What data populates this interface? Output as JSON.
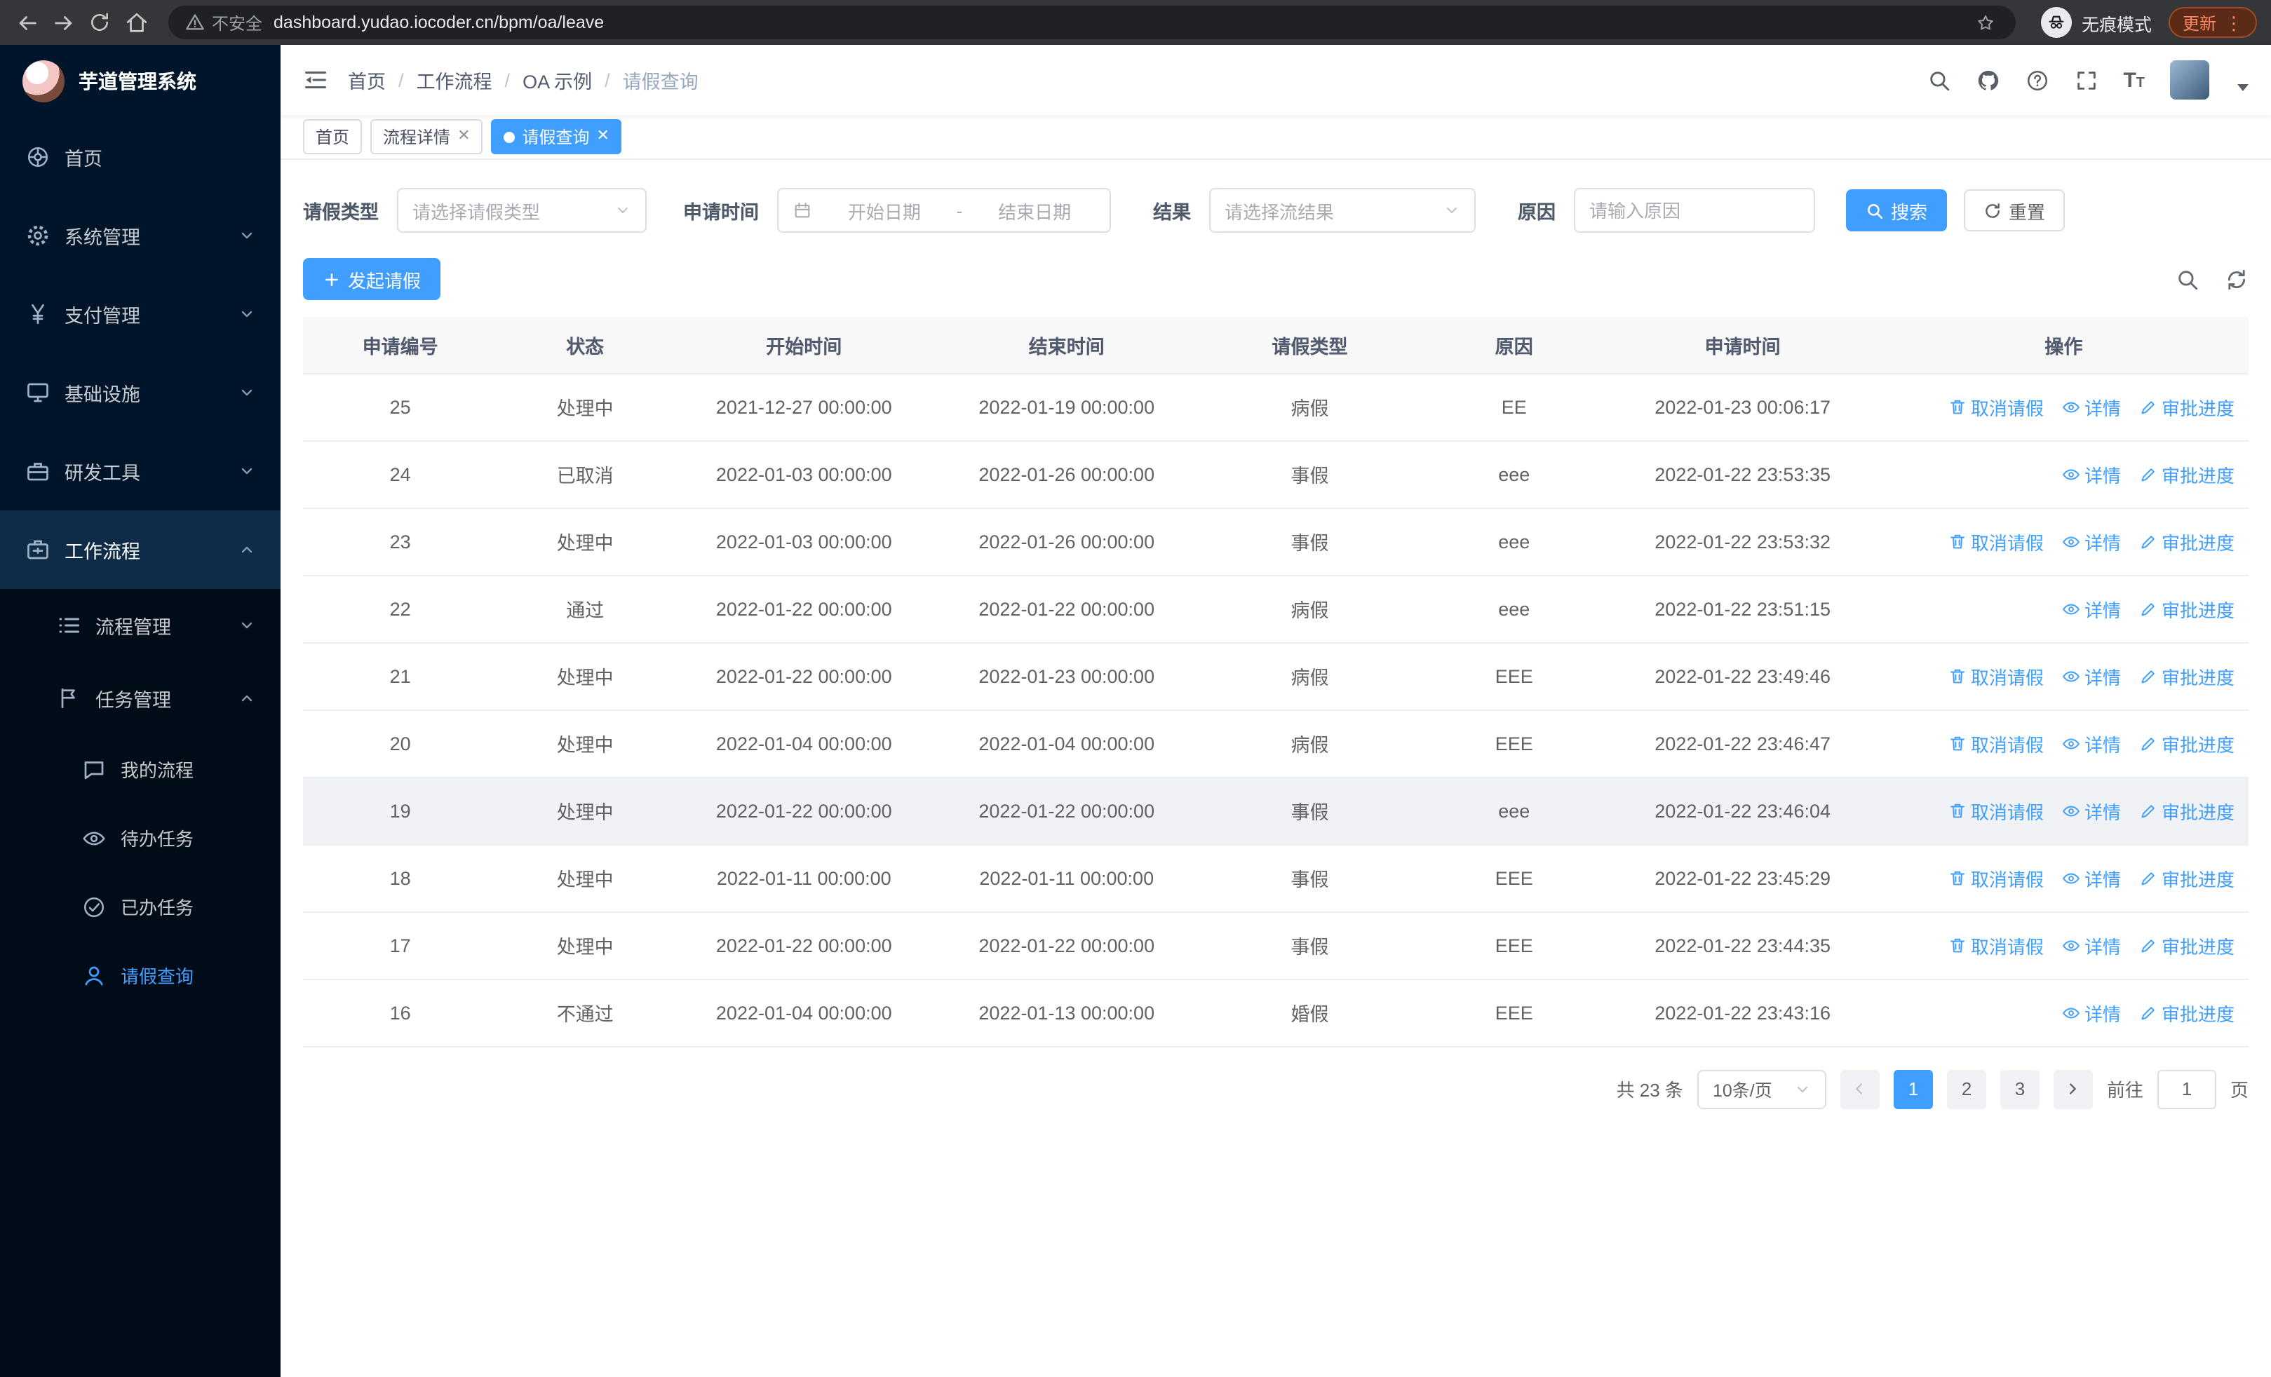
{
  "colors": {
    "primary": "#409eff",
    "sidebar_bg": "#001529",
    "submenu_bg": "#000c17",
    "chrome_bg": "#35363a",
    "header_text": "#515a6e"
  },
  "browser": {
    "security_label": "不安全",
    "url": "dashboard.yudao.iocoder.cn/bpm/oa/leave",
    "incognito_label": "无痕模式",
    "update_label": "更新"
  },
  "sidebar": {
    "logo_title": "芋道管理系统",
    "items": [
      {
        "label": "首页",
        "icon": "home-wheel-icon"
      },
      {
        "label": "系统管理",
        "icon": "gear-icon"
      },
      {
        "label": "支付管理",
        "icon": "yen-icon"
      },
      {
        "label": "基础设施",
        "icon": "monitor-icon"
      },
      {
        "label": "研发工具",
        "icon": "toolbox-icon"
      },
      {
        "label": "工作流程",
        "icon": "briefcase-icon"
      }
    ],
    "workflow_children": [
      {
        "label": "流程管理",
        "icon": "list-icon"
      },
      {
        "label": "任务管理",
        "icon": "flag-icon"
      }
    ],
    "task_children": [
      {
        "label": "我的流程",
        "icon": "chat-icon"
      },
      {
        "label": "待办任务",
        "icon": "eye-icon"
      },
      {
        "label": "已办任务",
        "icon": "check-circle-icon"
      },
      {
        "label": "请假查询",
        "icon": "user-icon"
      }
    ]
  },
  "header": {
    "breadcrumb": [
      "首页",
      "工作流程",
      "OA 示例",
      "请假查询"
    ]
  },
  "tabs": [
    {
      "label": "首页"
    },
    {
      "label": "流程详情"
    },
    {
      "label": "请假查询"
    }
  ],
  "filters": {
    "leave_type": {
      "label": "请假类型",
      "placeholder": "请选择请假类型"
    },
    "apply_time": {
      "label": "申请时间",
      "start_placeholder": "开始日期",
      "separator": "-",
      "end_placeholder": "结束日期"
    },
    "result": {
      "label": "结果",
      "placeholder": "请选择流结果"
    },
    "reason": {
      "label": "原因",
      "placeholder": "请输入原因"
    },
    "search_label": "搜索",
    "reset_label": "重置"
  },
  "toolbar": {
    "create_label": "发起请假"
  },
  "table": {
    "headers": [
      "申请编号",
      "状态",
      "开始时间",
      "结束时间",
      "请假类型",
      "原因",
      "申请时间",
      "操作"
    ],
    "action_labels": {
      "cancel": "取消请假",
      "detail": "详情",
      "progress": "审批进度"
    },
    "rows": [
      {
        "id": "25",
        "status": "处理中",
        "start": "2021-12-27 00:00:00",
        "end": "2022-01-19 00:00:00",
        "type": "病假",
        "reason": "EE",
        "applied": "2022-01-23 00:06:17",
        "actions": [
          "cancel",
          "detail",
          "progress"
        ]
      },
      {
        "id": "24",
        "status": "已取消",
        "start": "2022-01-03 00:00:00",
        "end": "2022-01-26 00:00:00",
        "type": "事假",
        "reason": "eee",
        "applied": "2022-01-22 23:53:35",
        "actions": [
          "detail",
          "progress"
        ]
      },
      {
        "id": "23",
        "status": "处理中",
        "start": "2022-01-03 00:00:00",
        "end": "2022-01-26 00:00:00",
        "type": "事假",
        "reason": "eee",
        "applied": "2022-01-22 23:53:32",
        "actions": [
          "cancel",
          "detail",
          "progress"
        ]
      },
      {
        "id": "22",
        "status": "通过",
        "start": "2022-01-22 00:00:00",
        "end": "2022-01-22 00:00:00",
        "type": "病假",
        "reason": "eee",
        "applied": "2022-01-22 23:51:15",
        "actions": [
          "detail",
          "progress"
        ]
      },
      {
        "id": "21",
        "status": "处理中",
        "start": "2022-01-22 00:00:00",
        "end": "2022-01-23 00:00:00",
        "type": "病假",
        "reason": "EEE",
        "applied": "2022-01-22 23:49:46",
        "actions": [
          "cancel",
          "detail",
          "progress"
        ]
      },
      {
        "id": "20",
        "status": "处理中",
        "start": "2022-01-04 00:00:00",
        "end": "2022-01-04 00:00:00",
        "type": "病假",
        "reason": "EEE",
        "applied": "2022-01-22 23:46:47",
        "actions": [
          "cancel",
          "detail",
          "progress"
        ]
      },
      {
        "id": "19",
        "status": "处理中",
        "start": "2022-01-22 00:00:00",
        "end": "2022-01-22 00:00:00",
        "type": "事假",
        "reason": "eee",
        "applied": "2022-01-22 23:46:04",
        "actions": [
          "cancel",
          "detail",
          "progress"
        ],
        "highlight": true
      },
      {
        "id": "18",
        "status": "处理中",
        "start": "2022-01-11 00:00:00",
        "end": "2022-01-11 00:00:00",
        "type": "事假",
        "reason": "EEE",
        "applied": "2022-01-22 23:45:29",
        "actions": [
          "cancel",
          "detail",
          "progress"
        ]
      },
      {
        "id": "17",
        "status": "处理中",
        "start": "2022-01-22 00:00:00",
        "end": "2022-01-22 00:00:00",
        "type": "事假",
        "reason": "EEE",
        "applied": "2022-01-22 23:44:35",
        "actions": [
          "cancel",
          "detail",
          "progress"
        ]
      },
      {
        "id": "16",
        "status": "不通过",
        "start": "2022-01-04 00:00:00",
        "end": "2022-01-13 00:00:00",
        "type": "婚假",
        "reason": "EEE",
        "applied": "2022-01-22 23:43:16",
        "actions": [
          "detail",
          "progress"
        ]
      }
    ]
  },
  "pagination": {
    "total_label": "共 23 条",
    "page_size_label": "10条/页",
    "pages": [
      "1",
      "2",
      "3"
    ],
    "active_page": "1",
    "goto_label": "前往",
    "goto_value": "1",
    "goto_suffix": "页"
  }
}
